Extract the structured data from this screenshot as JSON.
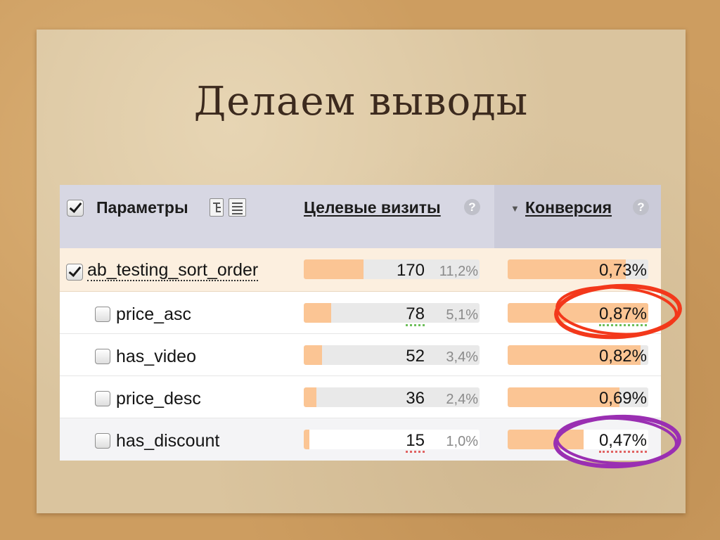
{
  "slide": {
    "title": "Делаем выводы"
  },
  "table": {
    "header": {
      "select_all_checked": true,
      "params_label": "Параметры",
      "visits_label": "Целевые визиты",
      "conversion_label": "Конверсия",
      "sort_indicator": "▼",
      "help_label": "?"
    },
    "rows": [
      {
        "name": "ab_testing_sort_order",
        "checked": true,
        "visits": "170",
        "share": "11,2%",
        "conversion": "0,73%",
        "underline_color": null
      },
      {
        "name": "price_asc",
        "checked": false,
        "visits": "78",
        "share": "5,1%",
        "conversion": "0,87%",
        "underline_color": "#6dbf5a"
      },
      {
        "name": "has_video",
        "checked": false,
        "visits": "52",
        "share": "3,4%",
        "conversion": "0,82%",
        "underline_color": null
      },
      {
        "name": "price_desc",
        "checked": false,
        "visits": "36",
        "share": "2,4%",
        "conversion": "0,69%",
        "underline_color": null
      },
      {
        "name": "has_discount",
        "checked": false,
        "visits": "15",
        "share": "1,0%",
        "conversion": "0,47%",
        "underline_color": "#e06262"
      }
    ]
  },
  "annotations": [
    {
      "row": 1,
      "color": "#f3381b"
    },
    {
      "row": 4,
      "color": "#9a2fb2"
    }
  ],
  "colors": {
    "bar_fill": "#fbc594",
    "bar_track": "#e9e9e9",
    "header_bg": "#d7d7e3",
    "sorted_header_bg": "#cbcbd9",
    "selected_row_bg": "#fcefdf",
    "title_color": "#3c2a1e"
  }
}
